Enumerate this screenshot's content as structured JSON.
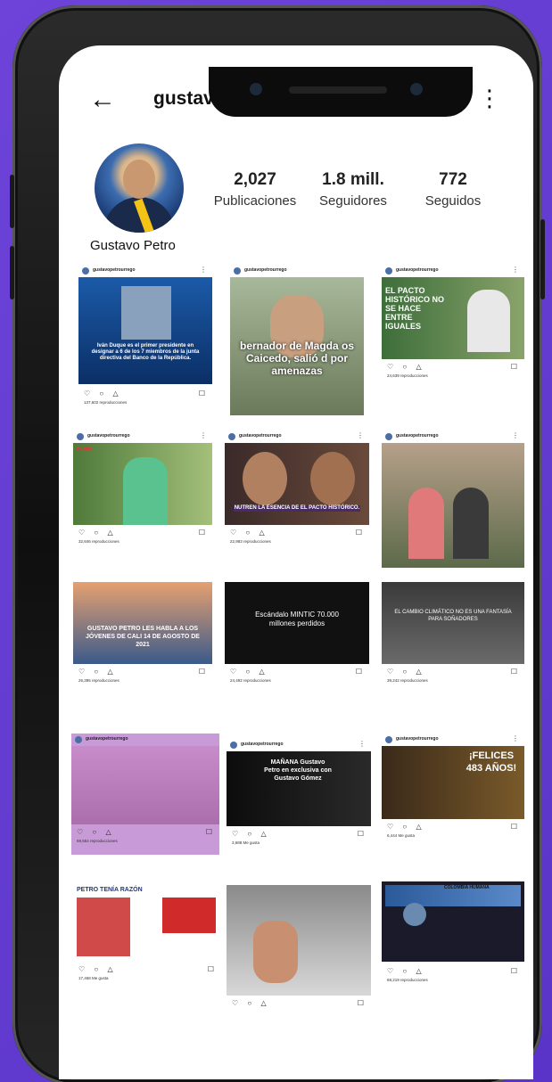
{
  "profile": {
    "username": "gustavopetrourrego",
    "full_name": "Gustavo Petro",
    "stats": [
      {
        "value": "2,027",
        "label": "Publicaciones"
      },
      {
        "value": "1.8 mill.",
        "label": "Seguidores"
      },
      {
        "value": "772",
        "label": "Seguidos"
      }
    ]
  },
  "icons": {
    "back": "arrow-left-icon",
    "verified": "verified-badge-icon",
    "bell": "bell-icon",
    "more": "more-vertical-icon"
  },
  "posts": [
    {
      "overlay": "Iván Duque es el primer presidente en designar a 6 de los 7 miembros de la junta directiva del Banco de la República.",
      "plays": "137,602 reproducciones"
    },
    {
      "overlay": "bernador de Magda os Caicedo, salió d por amenazas",
      "plays": ""
    },
    {
      "overlay": "EL PACTO HISTÓRICO NO SE HACE ENTRE IGUALES",
      "plays": "24,639 reproducciones"
    },
    {
      "overlay": "PETRO",
      "plays": "32,846 reproducciones"
    },
    {
      "overlay": "NUTREN LA ESENCIA DE EL PACTO HISTÓRICO.",
      "plays": "22,983 reproducciones"
    },
    {
      "overlay": "",
      "plays": ""
    },
    {
      "overlay": "GUSTAVO PETRO LES HABLA A LOS JÓVENES DE CALI 14 DE AGOSTO DE 2021",
      "plays": "26,395 reproducciones"
    },
    {
      "overlay": "Escándalo MINTIC 70.000 millones perdidos",
      "plays": "24,492 reproducciones"
    },
    {
      "overlay": "EL CAMBIO CLIMÁTICO NO ES UNA FANTASÍA PARA SOÑADORES",
      "plays": "39,242 reproducciones"
    },
    {
      "overlay": "",
      "plays": "69,554 reproducciones"
    },
    {
      "overlay": "MAÑANA Gustavo Petro en exclusiva con Gustavo Gómez",
      "plays": "3,688 Me gusta"
    },
    {
      "overlay": "¡FELICES 483 AÑOS!",
      "plays": "6,444 Me gusta"
    },
    {
      "overlay": "PETRO TENÍA RAZÓN",
      "plays": "17,468 Me gusta"
    },
    {
      "overlay": "",
      "plays": ""
    },
    {
      "overlay": "COLOMBIA HUMANA",
      "plays": "68,219 reproducciones"
    }
  ],
  "theme": {
    "accent": "#6d43d9",
    "verified": "#3897f0"
  }
}
